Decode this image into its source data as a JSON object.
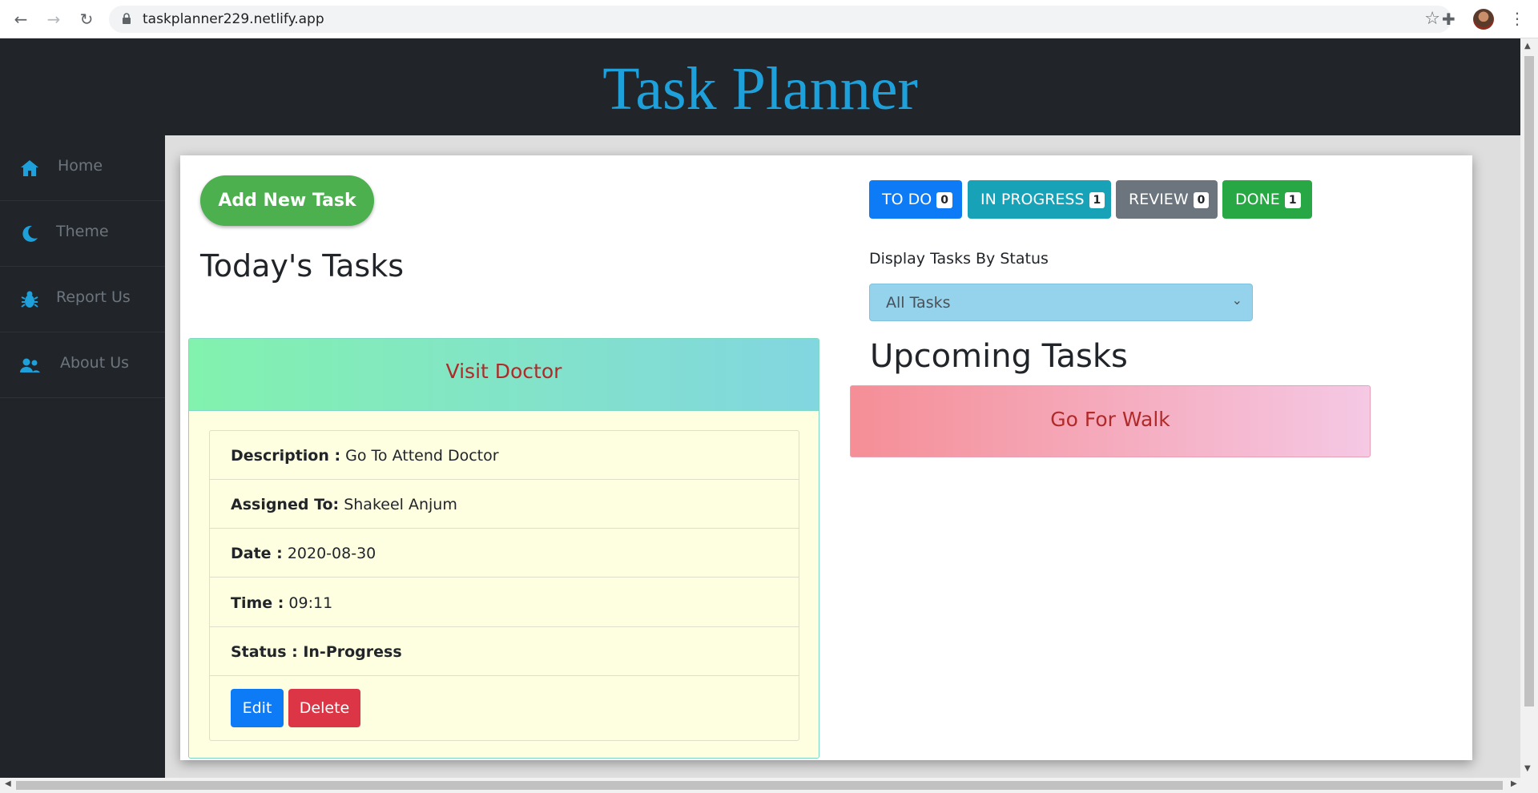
{
  "browser": {
    "url": "taskplanner229.netlify.app"
  },
  "app": {
    "title": "Task Planner"
  },
  "sidebar": {
    "items": [
      {
        "label": "Home",
        "icon": "home-icon"
      },
      {
        "label": "Theme",
        "icon": "moon-icon"
      },
      {
        "label": "Report Us",
        "icon": "bug-icon"
      },
      {
        "label": "About Us",
        "icon": "users-icon"
      }
    ]
  },
  "main": {
    "add_button": "Add New Task",
    "today_heading": "Today's Tasks",
    "upcoming_heading": "Upcoming Tasks",
    "status_buttons": [
      {
        "label": "TO DO",
        "count": "0",
        "color": "#0d7bf5"
      },
      {
        "label": "IN PROGRESS",
        "count": "1",
        "color": "#17a2b8"
      },
      {
        "label": "REVIEW",
        "count": "0",
        "color": "#6c757d"
      },
      {
        "label": "DONE",
        "count": "1",
        "color": "#28a745"
      }
    ],
    "filter": {
      "label": "Display Tasks By Status",
      "selected": "All Tasks"
    }
  },
  "today_task": {
    "title": "Visit Doctor",
    "rows": [
      {
        "key": "Description :",
        "value": " Go To Attend Doctor"
      },
      {
        "key": "Assigned To:",
        "value": " Shakeel Anjum"
      },
      {
        "key": "Date :",
        "value": " 2020-08-30"
      },
      {
        "key": "Time :",
        "value": " 09:11"
      },
      {
        "key": "Status : In-Progress",
        "value": ""
      }
    ],
    "edit_label": "Edit",
    "delete_label": "Delete"
  },
  "upcoming_task": {
    "title": "Go For Walk"
  },
  "colors": {
    "accent_title": "#1ea0db",
    "header_bg": "#212529",
    "task_title": "#b02a2a"
  }
}
